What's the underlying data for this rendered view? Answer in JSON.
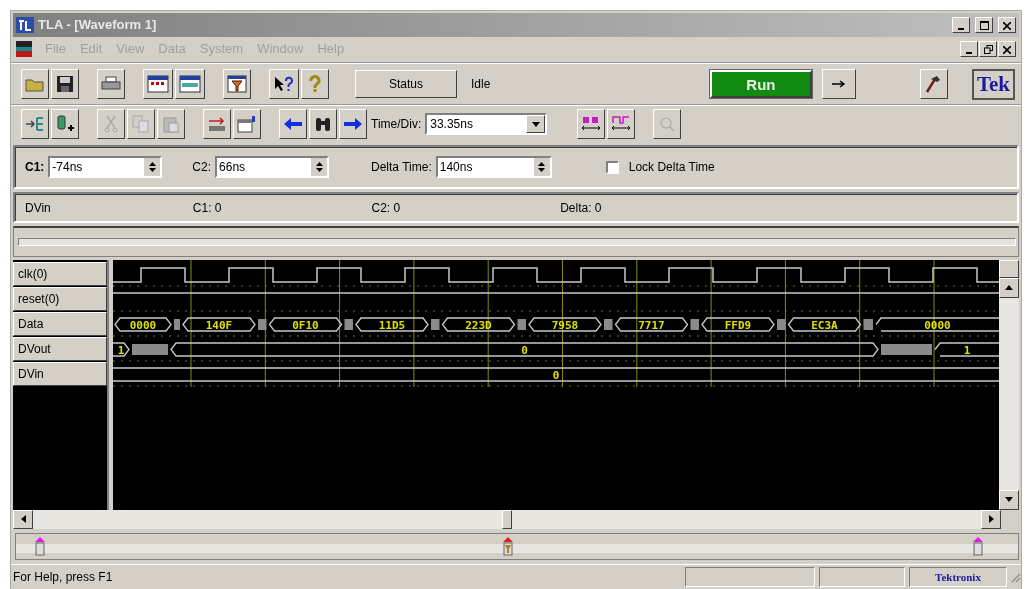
{
  "window": {
    "title": "TLA - [Waveform 1]"
  },
  "menu": [
    {
      "label": "File",
      "disabled": true
    },
    {
      "label": "Edit",
      "disabled": true
    },
    {
      "label": "View",
      "disabled": true
    },
    {
      "label": "Data",
      "disabled": true
    },
    {
      "label": "System",
      "disabled": true
    },
    {
      "label": "Window",
      "disabled": true
    },
    {
      "label": "Help",
      "disabled": true
    }
  ],
  "toolbar": {
    "status_button": "Status",
    "status_text": "Idle",
    "run_button": "Run",
    "logo": "Tek",
    "time_div_label": "Time/Div:",
    "time_div_value": "33.35ns"
  },
  "cursors": {
    "c1_label": "C1:",
    "c1_value": "-74ns",
    "c2_label": "C2:",
    "c2_value": "66ns",
    "delta_label": "Delta Time:",
    "delta_value": "140ns",
    "lock": {
      "label": "Lock Delta Time",
      "checked": false
    }
  },
  "readout": {
    "signal": "DVin",
    "c1": "C1: 0",
    "c2": "C2: 0",
    "delta": "Delta: 0"
  },
  "signals": [
    {
      "name": "clk(0)",
      "kind": "clock"
    },
    {
      "name": "reset(0)",
      "kind": "line"
    },
    {
      "name": "Data",
      "kind": "bus",
      "values": [
        "0000",
        "140F",
        "0F10",
        "11D5",
        "223D",
        "7958",
        "7717",
        "FFD9",
        "EC3A",
        "0000"
      ]
    },
    {
      "name": "DVout",
      "kind": "bus",
      "values": [
        "1",
        "0",
        "1"
      ]
    },
    {
      "name": "DVin",
      "kind": "bus",
      "values": [
        "0"
      ]
    }
  ],
  "status_bar": {
    "help": "For Help, press F1",
    "brand": "Tektronix"
  }
}
